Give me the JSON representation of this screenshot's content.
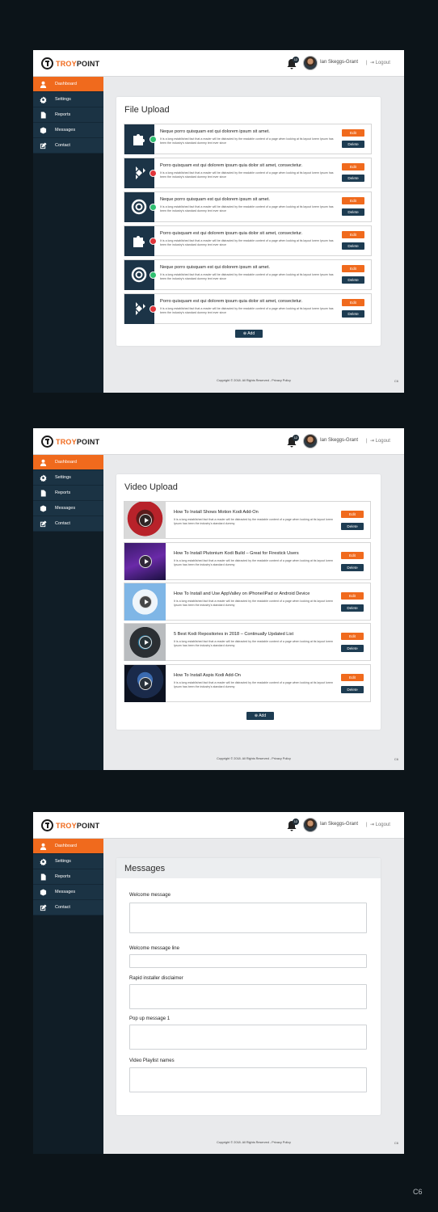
{
  "brand": {
    "troy": "TROY",
    "point": "POINT"
  },
  "header": {
    "notification_count": "12",
    "user_name": "Ian Skeggs-Grant",
    "separator": "|",
    "logout_label": "Logout"
  },
  "nav": [
    "Dashboard",
    "Settings",
    "Reports",
    "Messages",
    "Contact"
  ],
  "file_upload": {
    "title": "File Upload",
    "items": [
      {
        "title": "Neque porro quisquam est qui dolorem ipsum sit amet.",
        "desc": "It is a long established fact that a reader will be distracted by the readable content of a page when looking at its layout lorem Ipsum has been the industry's standard dummy text ever since",
        "icon": "puzzle-icon",
        "status": "ok"
      },
      {
        "title": "Porro quisquam est qui dolorem ipsum quia dolor sit amet, consectetur.",
        "desc": "It is a long established fact that a reader will be distracted by the readable content of a page when looking at its layout lorem Ipsum has been the industry's standard dummy text ever since",
        "icon": "kodi-icon",
        "status": "err"
      },
      {
        "title": "Neque porro quisquam est qui dolorem ipsum sit amet.",
        "desc": "It is a long established fact that a reader will be distracted by the readable content of a page when looking at its layout lorem Ipsum has been the industry's standard dummy text ever since",
        "icon": "lifebuoy-icon",
        "status": "ok"
      },
      {
        "title": "Porro quisquam est qui dolorem ipsum quia dolor sit amet, consectetur.",
        "desc": "It is a long established fact that a reader will be distracted by the readable content of a page when looking at its layout lorem Ipsum has been the industry's standard dummy text ever since",
        "icon": "puzzle-icon",
        "status": "err"
      },
      {
        "title": "Neque porro quisquam est qui dolorem ipsum sit amet.",
        "desc": "It is a long established fact that a reader will be distracted by the readable content of a page when looking at its layout lorem Ipsum has been the industry's standard dummy text ever since",
        "icon": "lifebuoy-icon",
        "status": "ok"
      },
      {
        "title": "Porro quisquam est qui dolorem ipsum quia dolor sit amet, consectetur.",
        "desc": "It is a long established fact that a reader will be distracted by the readable content of a page when looking at its layout lorem Ipsum has been the industry's standard dummy text ever since",
        "icon": "kodi-icon",
        "status": "err"
      }
    ]
  },
  "video_upload": {
    "title": "Video Upload",
    "items": [
      {
        "title": "How To Install Shows Motion Kodi Add-On",
        "desc": "It is a long established fact that a reader will be distracted by the readable content of a page when looking at its layout lorem Ipsum has been the industry's standard dummy"
      },
      {
        "title": "How To Install Plutonium Kodi Build – Great for Firestick Users",
        "desc": "It is a long established fact that a reader will be distracted by the readable content of a page when looking at its layout lorem Ipsum has been the industry's standard dummy"
      },
      {
        "title": "How To Install and Use AppValley on iPhone/iPad or Android Device",
        "desc": "It is a long established fact that a reader will be distracted by the readable content of a page when looking at its layout lorem Ipsum has been the industry's standard dummy"
      },
      {
        "title": "5 Best Kodi Repositories in 2018 – Continually Updated List",
        "desc": "It is a long established fact that a reader will be distracted by the readable content of a page when looking at its layout lorem Ipsum has been the industry's standard dummy"
      },
      {
        "title": "How To Install Aspis Kodi Add-On",
        "desc": "It is a long established fact that a reader will be distracted by the readable content of a page when looking at its layout lorem Ipsum has been the industry's standard dummy"
      }
    ]
  },
  "messages": {
    "title": "Messages",
    "fields": [
      "Welcome message",
      "Welcome message line",
      "Rapid installer disclaimer",
      "Pop up message 1",
      "Video Playlist names"
    ]
  },
  "buttons": {
    "edit": "Edit",
    "delete": "Delete",
    "add": "Add"
  },
  "footer": {
    "copyright": "Copyright © 2018. All Rights Reserved - Privacy Policy",
    "mark": "C6"
  },
  "corner_mark": "C6",
  "colors": {
    "accent": "#f06a1d",
    "navy": "#1d3c52",
    "sidebar": "#101d26",
    "ok": "#2fbf71",
    "error": "#e0343a"
  }
}
